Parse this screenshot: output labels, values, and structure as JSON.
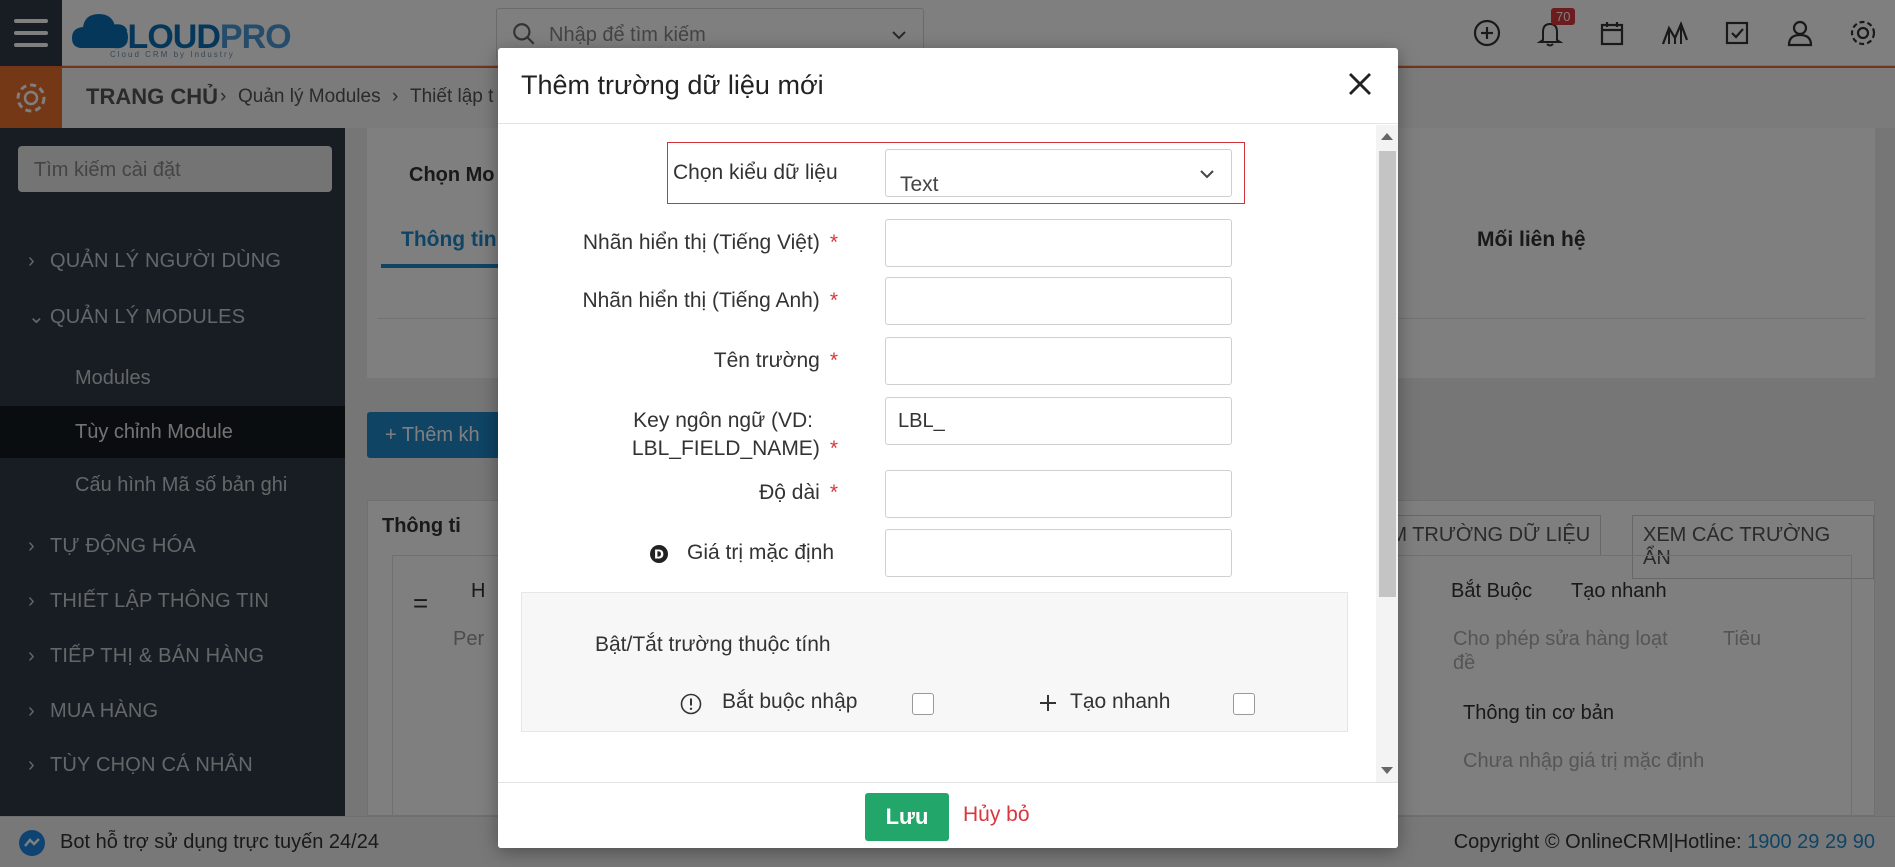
{
  "header": {
    "logo_main": "CLOUD",
    "logo_accent": "PRO",
    "logo_tagline": "Cloud CRM by Industry",
    "search_placeholder": "Nhập để tìm kiếm",
    "notification_count": "70"
  },
  "breadcrumb": {
    "home": "TRANG CHỦ",
    "items": [
      "Quản lý Modules",
      "Thiết lập t"
    ]
  },
  "sidebar": {
    "search_placeholder": "Tìm kiếm cài đặt",
    "sections": [
      {
        "label": "QUẢN LÝ NGƯỜI DÙNG",
        "expanded": false
      },
      {
        "label": "QUẢN LÝ MODULES",
        "expanded": true
      },
      {
        "label": "TỰ ĐỘNG HÓA",
        "expanded": false
      },
      {
        "label": "THIẾT LẬP THÔNG TIN",
        "expanded": false
      },
      {
        "label": "TIẾP THỊ & BÁN HÀNG",
        "expanded": false
      },
      {
        "label": "MUA HÀNG",
        "expanded": false
      },
      {
        "label": "TÙY CHỌN CÁ NHÂN",
        "expanded": false
      }
    ],
    "module_items": [
      "Modules",
      "Tùy chỉnh Module",
      "Cấu hình Mã số bản ghi"
    ]
  },
  "background": {
    "chon_mo": "Chọn Mo",
    "tab_thong_tin": "Thông tin",
    "tab_moi_lien_he": "Mối liên hệ",
    "add_block_btn": "+ Thêm kh",
    "block_title": "Thông ti",
    "add_field_btn": "EM TRƯỜNG DỮ LIỆU",
    "view_hidden_btn": "XEM CÁC TRƯỜNG ẨN",
    "field_h": "H",
    "field_per": "Per",
    "prop_required": "Bắt Buộc",
    "prop_quick": "Tạo nhanh",
    "prop_mass_edit": "Cho phép sửa hàng loạt",
    "prop_title": "Tiêu",
    "prop_title2": "đề",
    "prop_basic_info": "Thông tin cơ bản",
    "prop_no_default": "Chưa nhập giá trị mặc định"
  },
  "modal": {
    "title": "Thêm trường dữ liệu mới",
    "fields": {
      "data_type_label": "Chọn kiểu dữ liệu",
      "data_type_value": "Text",
      "label_vi": "Nhãn hiển thị (Tiếng Việt)",
      "label_en": "Nhãn hiển thị (Tiếng Anh)",
      "field_name": "Tên trường",
      "lang_key_line1": "Key ngôn ngữ (VD:",
      "lang_key_line2": "LBL_FIELD_NAME)",
      "lang_key_value": "LBL_",
      "length": "Độ dài",
      "default_value": "Giá trị mặc định",
      "required_mark": "*"
    },
    "properties": {
      "title": "Bật/Tắt trường thuộc tính",
      "required": "Bắt buộc nhập",
      "quick_create": "Tạo nhanh"
    },
    "save_button": "Lưu",
    "cancel_button": "Hủy bỏ"
  },
  "footer": {
    "bot_text": "Bot hỗ trợ sử dụng trực tuyến 24/24",
    "copyright": "Copyright © OnlineCRM|Hotline: ",
    "hotline": "1900 29 29 90"
  }
}
